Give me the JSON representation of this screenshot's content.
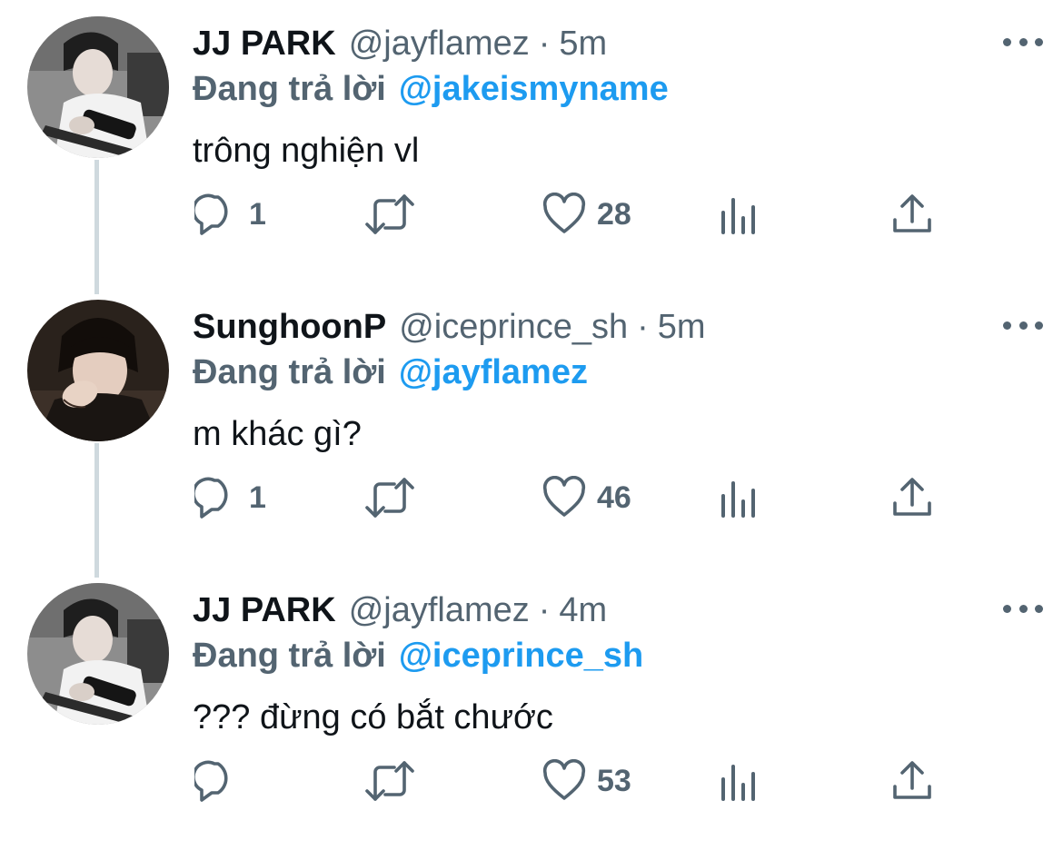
{
  "reply_label": "Đang trả lời",
  "colors": {
    "text": "#0f1419",
    "secondary": "#536471",
    "mention": "#1d9bf0",
    "thread_line": "#cfd9de"
  },
  "tweets": [
    {
      "name": "JJ PARK",
      "handle": "@jayflamez",
      "separator": "·",
      "time": "5m",
      "replying_to": "@jakeismyname",
      "text": "trông nghiện vl",
      "reply_count": "1",
      "retweet_count": "",
      "like_count": "28",
      "avatar": "guitar-player-photo"
    },
    {
      "name": "SunghoonP",
      "handle": "@iceprince_sh",
      "separator": "·",
      "time": "5m",
      "replying_to": "@jayflamez",
      "text": "m khác gì?",
      "reply_count": "1",
      "retweet_count": "",
      "like_count": "46",
      "avatar": "portrait-photo"
    },
    {
      "name": "JJ PARK",
      "handle": "@jayflamez",
      "separator": "·",
      "time": "4m",
      "replying_to": "@iceprince_sh",
      "text": "??? đừng có bắt chước",
      "reply_count": "",
      "retweet_count": "",
      "like_count": "53",
      "avatar": "guitar-player-photo"
    }
  ]
}
